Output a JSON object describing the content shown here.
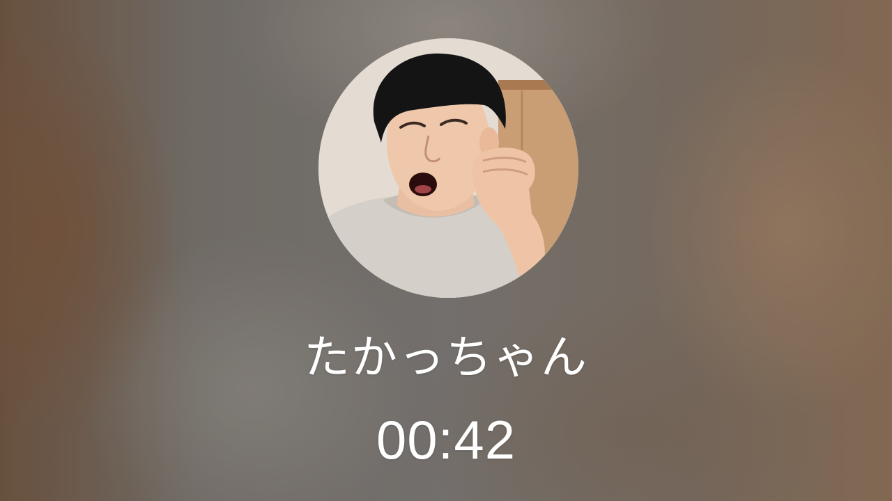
{
  "call": {
    "caller_name": "たかっちゃん",
    "elapsed_time": "00:42",
    "avatar_icon": "caller-photo"
  },
  "colors": {
    "text": "#ffffff",
    "background": "#6b6560"
  }
}
